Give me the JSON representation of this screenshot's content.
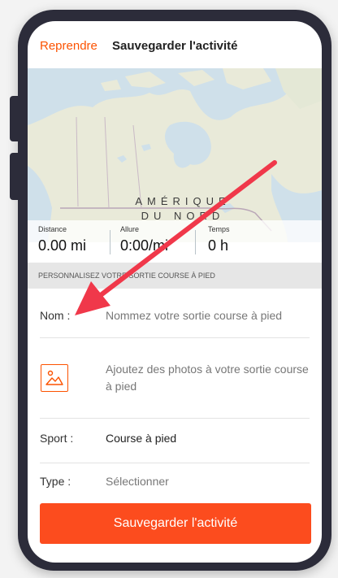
{
  "header": {
    "back_label": "Reprendre",
    "title": "Sauvegarder l'activité"
  },
  "map": {
    "label_line1": "AMÉRIQUE",
    "label_line2": "DU NORD"
  },
  "stats": [
    {
      "label": "Distance",
      "value": "0.00 mi"
    },
    {
      "label": "Allure",
      "value": "0:00/mi"
    },
    {
      "label": "Temps",
      "value": "0 h"
    }
  ],
  "section_header": "PERSONNALISEZ VOTRE SORTIE COURSE À PIED",
  "form": {
    "name_label": "Nom :",
    "name_placeholder": "Nommez votre sortie course à pied",
    "photo_text": "Ajoutez des photos à votre sortie course à pied",
    "sport_label": "Sport :",
    "sport_value": "Course à pied",
    "type_label": "Type :",
    "type_value": "Sélectionner"
  },
  "save_button": "Sauvegarder l'activité",
  "colors": {
    "accent": "#fc5200",
    "button": "#fc4c1e",
    "annotation_arrow": "#f0384a"
  }
}
